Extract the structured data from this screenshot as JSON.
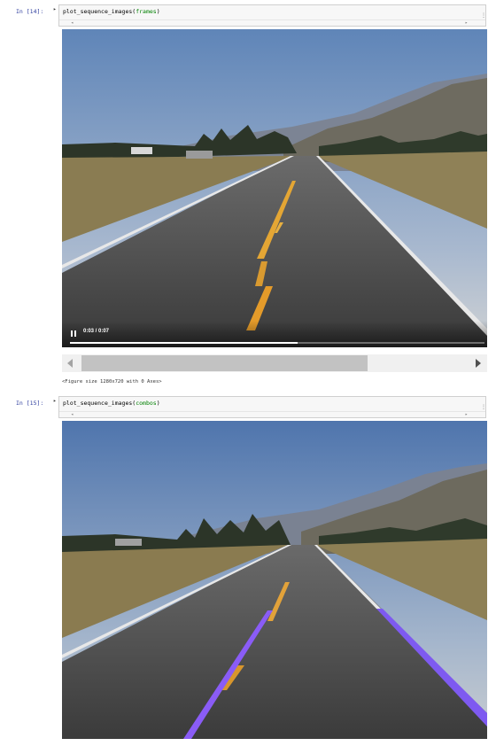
{
  "cells": [
    {
      "prompt": "In [14]:",
      "code_fn": "plot_sequence_images",
      "code_arg": "frames",
      "video": {
        "time": "0:03 / 0:07",
        "progress": 0.55
      },
      "output_text": "<Figure size 1280x720 with 0 Axes>"
    },
    {
      "prompt": "In [15]:",
      "code_fn": "plot_sequence_images",
      "code_arg": "combos"
    }
  ],
  "icons": {
    "collapse": "collapse-triangle-icon",
    "pause": "pause-icon",
    "scroll_left": "scroll-left-arrow-icon",
    "scroll_right": "scroll-right-arrow-icon"
  },
  "colors": {
    "prompt": "#303f9f",
    "lane_overlay": "#8a5cf6",
    "center_line": "#e0a030"
  }
}
